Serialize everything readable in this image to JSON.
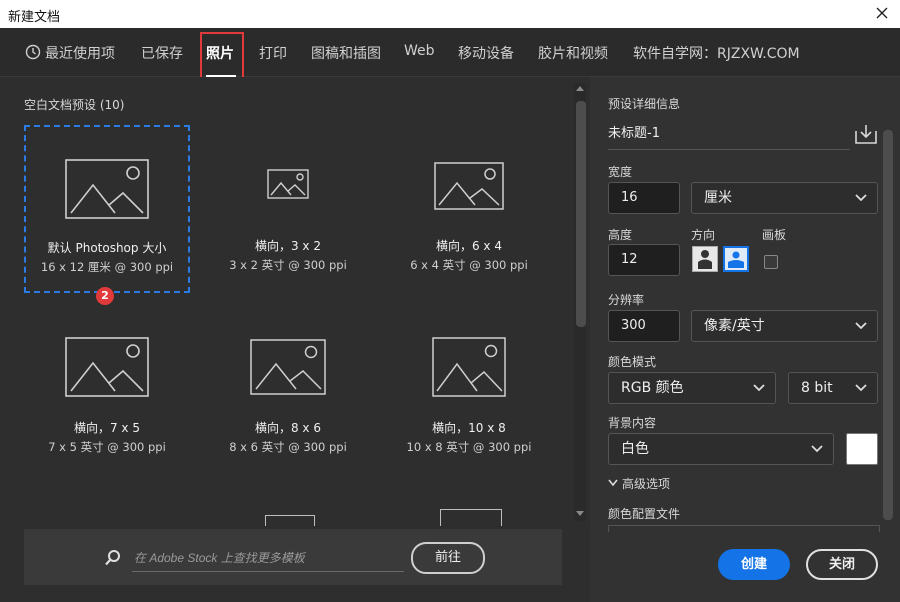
{
  "window": {
    "title": "新建文档",
    "close_icon": "close-icon"
  },
  "tabs": [
    {
      "label": "最近使用项",
      "icon": "clock-icon"
    },
    {
      "label": "已保存"
    },
    {
      "label": "照片",
      "active": true
    },
    {
      "label": "打印"
    },
    {
      "label": "图稿和插图"
    },
    {
      "label": "Web"
    },
    {
      "label": "移动设备"
    },
    {
      "label": "胶片和视频"
    },
    {
      "label": "软件自学网：RJZXW.COM"
    }
  ],
  "annotations": {
    "tab_marker": "1",
    "card_marker": "2",
    "marker_color": "#e03a3a"
  },
  "presets": {
    "section_title": "空白文档预设 (10)",
    "items": [
      {
        "name": "默认 Photoshop 大小",
        "size": "16 x 12 厘米 @ 300 ppi",
        "selected": true
      },
      {
        "name": "横向，3 x 2",
        "size": "3 x 2 英寸 @ 300 ppi"
      },
      {
        "name": "横向，6 x 4",
        "size": "6 x 4 英寸 @ 300 ppi"
      },
      {
        "name": "横向，7 x 5",
        "size": "7 x 5 英寸 @ 300 ppi"
      },
      {
        "name": "横向，8 x 6",
        "size": "8 x 6 英寸 @ 300 ppi"
      },
      {
        "name": "横向，10 x 8",
        "size": "10 x 8 英寸 @ 300 ppi"
      }
    ]
  },
  "stock_search": {
    "placeholder": "在 Adobe Stock 上查找更多模板",
    "go_label": "前往"
  },
  "details": {
    "heading": "预设详细信息",
    "doc_name": "未标题-1",
    "width_label": "宽度",
    "width_value": "16",
    "width_unit": "厘米",
    "height_label": "高度",
    "height_value": "12",
    "orientation_label": "方向",
    "artboard_label": "画板",
    "resolution_label": "分辨率",
    "resolution_value": "300",
    "resolution_unit": "像素/英寸",
    "color_mode_label": "颜色模式",
    "color_mode": "RGB 颜色",
    "bit_depth": "8 bit",
    "background_label": "背景内容",
    "background_value": "白色",
    "background_color": "#ffffff",
    "advanced_label": "高级选项",
    "color_profile_label": "颜色配置文件"
  },
  "buttons": {
    "create": "创建",
    "close": "关闭"
  },
  "colors": {
    "accent": "#1473e6",
    "selection": "#2c7be5"
  }
}
